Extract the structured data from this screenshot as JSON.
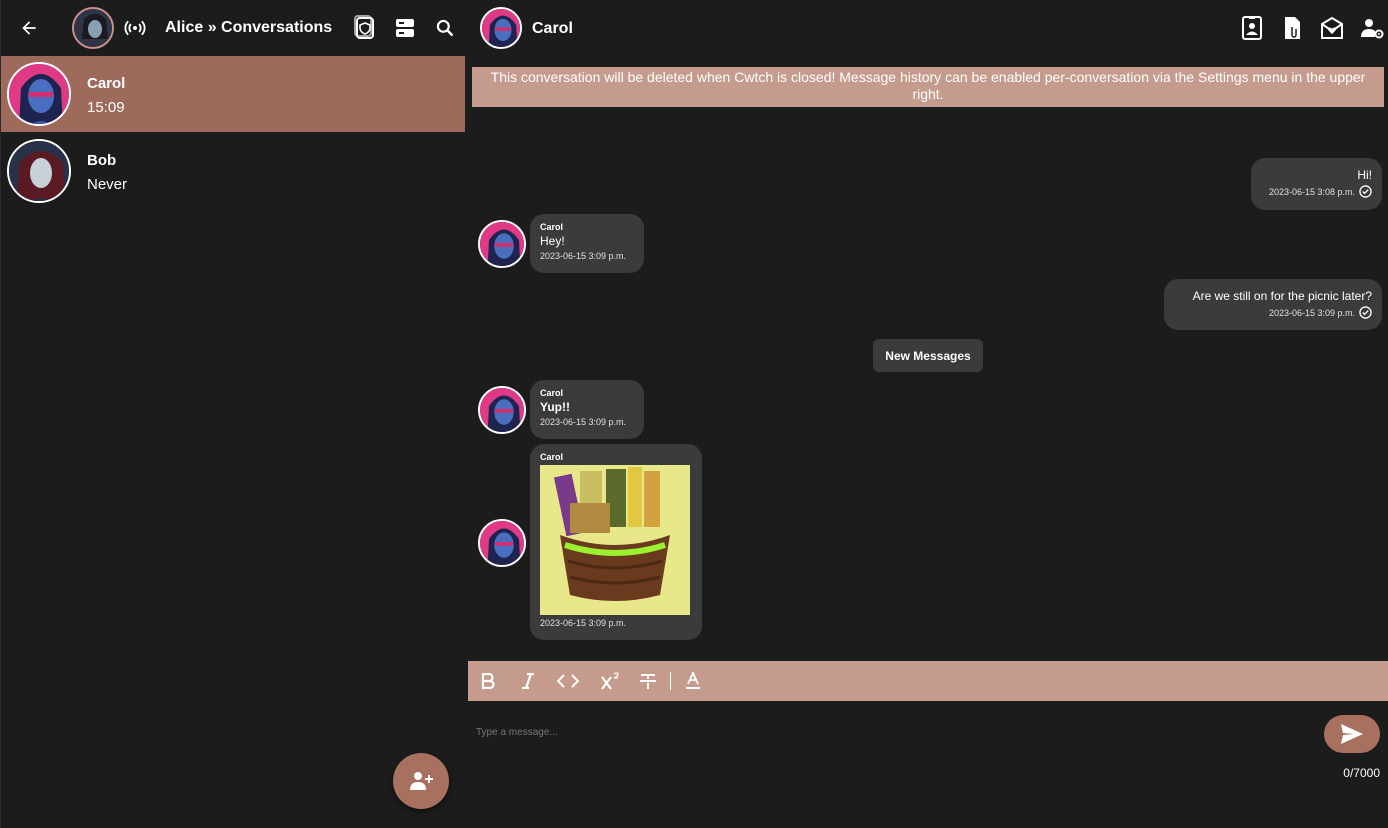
{
  "left_header": {
    "title": "Alice » Conversations"
  },
  "contacts": [
    {
      "name": "Carol",
      "subtitle": "15:09",
      "selected": true
    },
    {
      "name": "Bob",
      "subtitle": "Never",
      "selected": false
    }
  ],
  "chat_header": {
    "title": "Carol"
  },
  "banner": {
    "text": "This conversation will be deleted when Cwtch is closed! Message history can be enabled per-conversation via the Settings menu in the upper right."
  },
  "messages": [
    {
      "sender": "",
      "text": "Hi!",
      "timestamp": "2023-06-15 3:08 p.m.",
      "mine": true
    },
    {
      "sender": "Carol",
      "text": "Hey!",
      "timestamp": "2023-06-15 3:09 p.m.",
      "mine": false
    },
    {
      "sender": "",
      "text": "Are we still on for the picnic later?",
      "timestamp": "2023-06-15 3:09 p.m.",
      "mine": true
    },
    {
      "sender": "Carol",
      "text": "Yup!!",
      "timestamp": "2023-06-15 3:09 p.m.",
      "mine": false
    },
    {
      "sender": "Carol",
      "text": "",
      "timestamp": "2023-06-15 3:09 p.m.",
      "mine": false,
      "image": "picnic-basket-image"
    }
  ],
  "divider": {
    "new_messages_label": "New Messages"
  },
  "composer": {
    "placeholder": "Type a message...",
    "counter": "0/7000"
  },
  "colors": {
    "accent": "#a8705f",
    "selected_row": "#9e6a5c",
    "toolbar": "#c49b8d",
    "bubble": "#3b3b3b",
    "background": "#1c1c1c"
  },
  "icons": {
    "back": "arrow-left-icon",
    "network": "broadcast-icon",
    "qr": "qr-shield-icon",
    "servers": "server-icon",
    "search": "search-icon",
    "profile_card": "contact-card-icon",
    "files": "shared-files-icon",
    "manage": "manage-contact-icon",
    "settings": "conversation-settings-icon",
    "add_contact": "add-contact-icon",
    "send": "send-icon"
  }
}
